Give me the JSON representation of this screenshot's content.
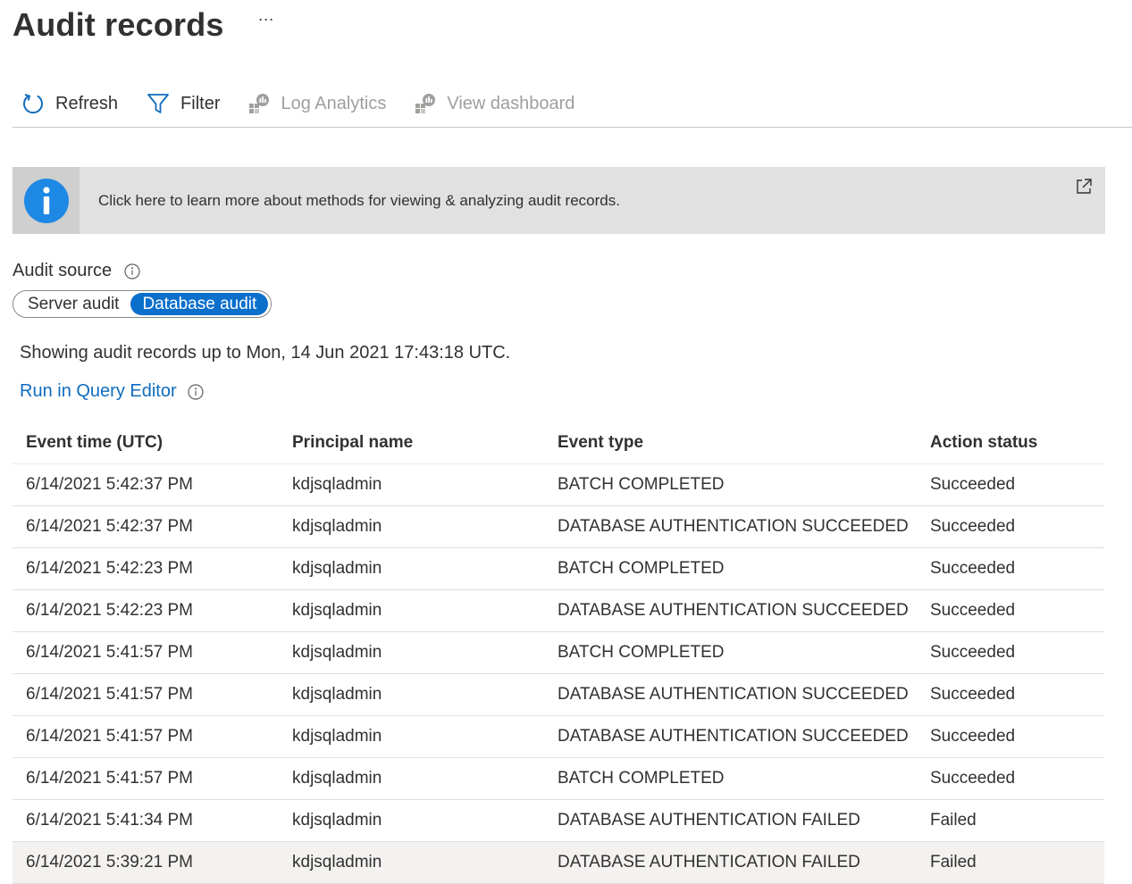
{
  "page": {
    "title": "Audit records",
    "more": "···"
  },
  "toolbar": {
    "refresh": "Refresh",
    "filter": "Filter",
    "log_analytics": "Log Analytics",
    "view_dashboard": "View dashboard"
  },
  "banner": {
    "text": "Click here to learn more about methods for viewing & analyzing audit records."
  },
  "audit_source": {
    "label": "Audit source",
    "options": [
      "Server audit",
      "Database audit"
    ],
    "selected": "Database audit"
  },
  "showing_text": "Showing audit records up to Mon, 14 Jun 2021 17:43:18 UTC.",
  "query_link": "Run in Query Editor",
  "table": {
    "columns": [
      "Event time (UTC)",
      "Principal name",
      "Event type",
      "Action status"
    ],
    "rows": [
      [
        "6/14/2021 5:42:37 PM",
        "kdjsqladmin",
        "BATCH COMPLETED",
        "Succeeded"
      ],
      [
        "6/14/2021 5:42:37 PM",
        "kdjsqladmin",
        "DATABASE AUTHENTICATION SUCCEEDED",
        "Succeeded"
      ],
      [
        "6/14/2021 5:42:23 PM",
        "kdjsqladmin",
        "BATCH COMPLETED",
        "Succeeded"
      ],
      [
        "6/14/2021 5:42:23 PM",
        "kdjsqladmin",
        "DATABASE AUTHENTICATION SUCCEEDED",
        "Succeeded"
      ],
      [
        "6/14/2021 5:41:57 PM",
        "kdjsqladmin",
        "BATCH COMPLETED",
        "Succeeded"
      ],
      [
        "6/14/2021 5:41:57 PM",
        "kdjsqladmin",
        "DATABASE AUTHENTICATION SUCCEEDED",
        "Succeeded"
      ],
      [
        "6/14/2021 5:41:57 PM",
        "kdjsqladmin",
        "DATABASE AUTHENTICATION SUCCEEDED",
        "Succeeded"
      ],
      [
        "6/14/2021 5:41:57 PM",
        "kdjsqladmin",
        "BATCH COMPLETED",
        "Succeeded"
      ],
      [
        "6/14/2021 5:41:34 PM",
        "kdjsqladmin",
        "DATABASE AUTHENTICATION FAILED",
        "Failed"
      ],
      [
        "6/14/2021 5:39:21 PM",
        "kdjsqladmin",
        "DATABASE AUTHENTICATION FAILED",
        "Failed"
      ]
    ]
  },
  "colors": {
    "accent": "#0f6cbd",
    "info_icon": "#1e88e5",
    "banner_bg": "#e1e1e1"
  },
  "icons": {
    "refresh": "refresh-icon",
    "filter": "filter-icon",
    "log_analytics": "log-analytics-icon",
    "view_dashboard": "dashboard-icon",
    "info": "info-icon",
    "external_link": "external-link-icon"
  }
}
